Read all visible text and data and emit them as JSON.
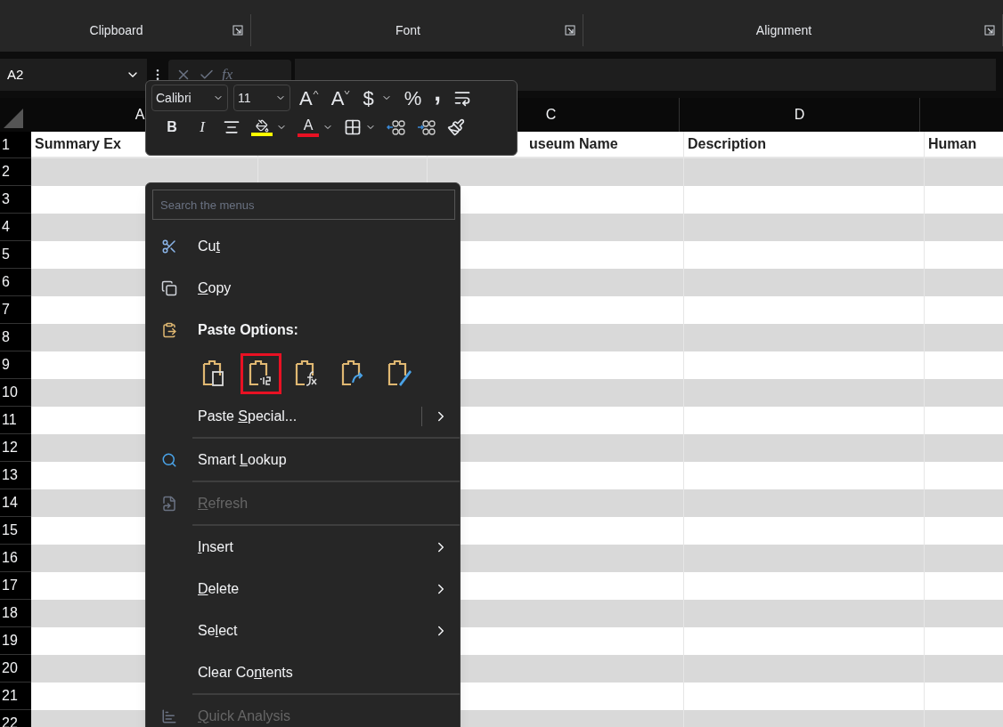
{
  "ribbon_groups": [
    {
      "label": "Clipboard"
    },
    {
      "label": "Font"
    },
    {
      "label": "Alignment"
    }
  ],
  "formula_bar": {
    "name_box": "A2",
    "function_label": "fx"
  },
  "mini_toolbar": {
    "font": "Calibri",
    "size": "11",
    "row_1": [
      {
        "kind": "grow",
        "label": "A"
      },
      {
        "kind": "shrink",
        "label": "A"
      },
      {
        "kind": "currency",
        "label": "$"
      },
      {
        "kind": "percent",
        "label": "%"
      },
      {
        "kind": "comma",
        "label": ","
      },
      {
        "kind": "wrap"
      }
    ],
    "row_2": [
      {
        "kind": "bold",
        "label": "B"
      },
      {
        "kind": "italic",
        "label": "I"
      },
      {
        "kind": "align"
      },
      {
        "kind": "fill",
        "color": "#ffff00"
      },
      {
        "kind": "fontcolor",
        "label": "A",
        "color": "#e81123"
      },
      {
        "kind": "borders"
      },
      {
        "kind": "increase_decimal"
      },
      {
        "kind": "decrease_decimal"
      },
      {
        "kind": "painter"
      }
    ]
  },
  "sheet": {
    "columns": [
      {
        "header": "A",
        "row_1": "Summary Ex"
      },
      {},
      {
        "header": "C",
        "row_1": "useum Name"
      },
      {
        "header": "D",
        "row_1": "Description"
      },
      {
        "row_1": "Human"
      }
    ],
    "row_numbers": [
      "1",
      "2",
      "3",
      "4",
      "5",
      "6",
      "7",
      "8",
      "9",
      "10",
      "11",
      "12",
      "13",
      "14",
      "15",
      "16",
      "17",
      "18",
      "19",
      "20",
      "21",
      "22"
    ]
  },
  "context_menu": {
    "search": {
      "placeholder": "Search the menus"
    },
    "items": [
      {
        "kind": "item",
        "before": "Cu",
        "key": "t",
        "disabled": false,
        "submenu": false,
        "divider_before": false
      },
      {
        "kind": "item",
        "key": "C",
        "after": "opy",
        "disabled": false,
        "submenu": false,
        "divider_before": false
      },
      {
        "kind": "heading",
        "label": "Paste Options:"
      },
      {
        "kind": "paste_options",
        "options": [
          {
            "selected": false
          },
          {
            "selected": true
          },
          {
            "selected": false
          },
          {
            "selected": false
          },
          {
            "selected": false
          }
        ]
      },
      {
        "kind": "item",
        "before": "Paste ",
        "key": "S",
        "after": "pecial...",
        "disabled": false,
        "submenu": true,
        "divider_before": false
      },
      {
        "kind": "item",
        "before": "Smart ",
        "key": "L",
        "after": "ookup",
        "disabled": false,
        "submenu": false,
        "divider_before": true
      },
      {
        "kind": "item",
        "key": "R",
        "after": "efresh",
        "disabled": true,
        "submenu": false,
        "divider_before": true
      },
      {
        "kind": "item",
        "key": "I",
        "after": "nsert",
        "disabled": false,
        "submenu": true,
        "divider_before": true
      },
      {
        "kind": "item",
        "key": "D",
        "after": "elete",
        "disabled": false,
        "submenu": true,
        "divider_before": false
      },
      {
        "kind": "item",
        "before": "Se",
        "key": "l",
        "after": "ect",
        "disabled": false,
        "submenu": true,
        "divider_before": false
      },
      {
        "kind": "item",
        "before": "Clear Co",
        "key": "n",
        "after": "tents",
        "disabled": false,
        "submenu": false,
        "divider_before": false
      },
      {
        "kind": "item",
        "key": "Q",
        "after": "uick Analysis",
        "disabled": true,
        "submenu": false,
        "divider_before": true
      }
    ]
  }
}
